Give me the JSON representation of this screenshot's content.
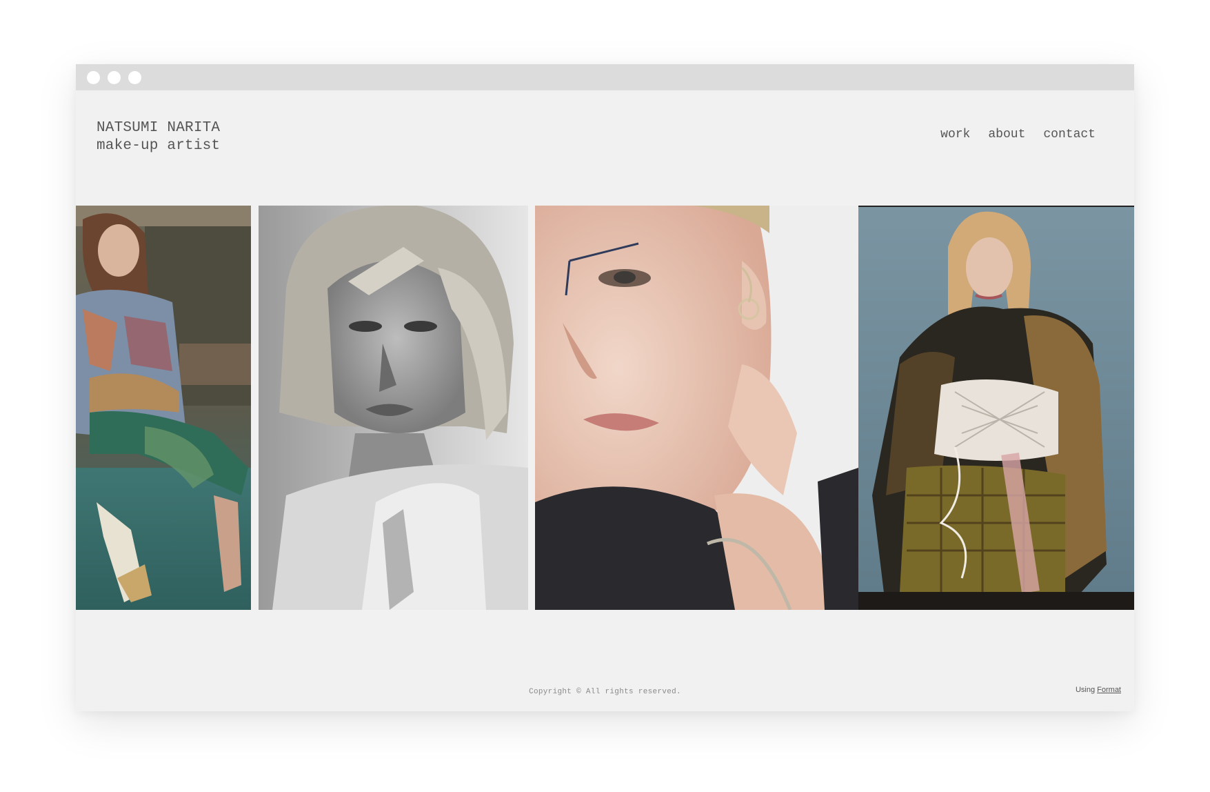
{
  "window": {
    "controls": [
      "close",
      "minimize",
      "maximize"
    ]
  },
  "header": {
    "name": "NATSUMI NARITA",
    "tagline": "make-up artist"
  },
  "nav": {
    "items": [
      {
        "label": "work"
      },
      {
        "label": "about"
      },
      {
        "label": "contact"
      }
    ]
  },
  "gallery": {
    "photos": [
      {
        "subject": "model-seated-floral-outfit"
      },
      {
        "subject": "model-portrait-black-and-white"
      },
      {
        "subject": "model-closeup-drawn-brow"
      },
      {
        "subject": "model-corset-brocade-coat"
      }
    ]
  },
  "footer": {
    "copyright": "Copyright © All rights reserved.",
    "using_label": "Using",
    "using_link": "Format"
  },
  "colors": {
    "page_background": "#f1f1f1",
    "titlebar": "#dcdcdc",
    "text": "#555555",
    "footer_text": "#8a8a8a"
  }
}
